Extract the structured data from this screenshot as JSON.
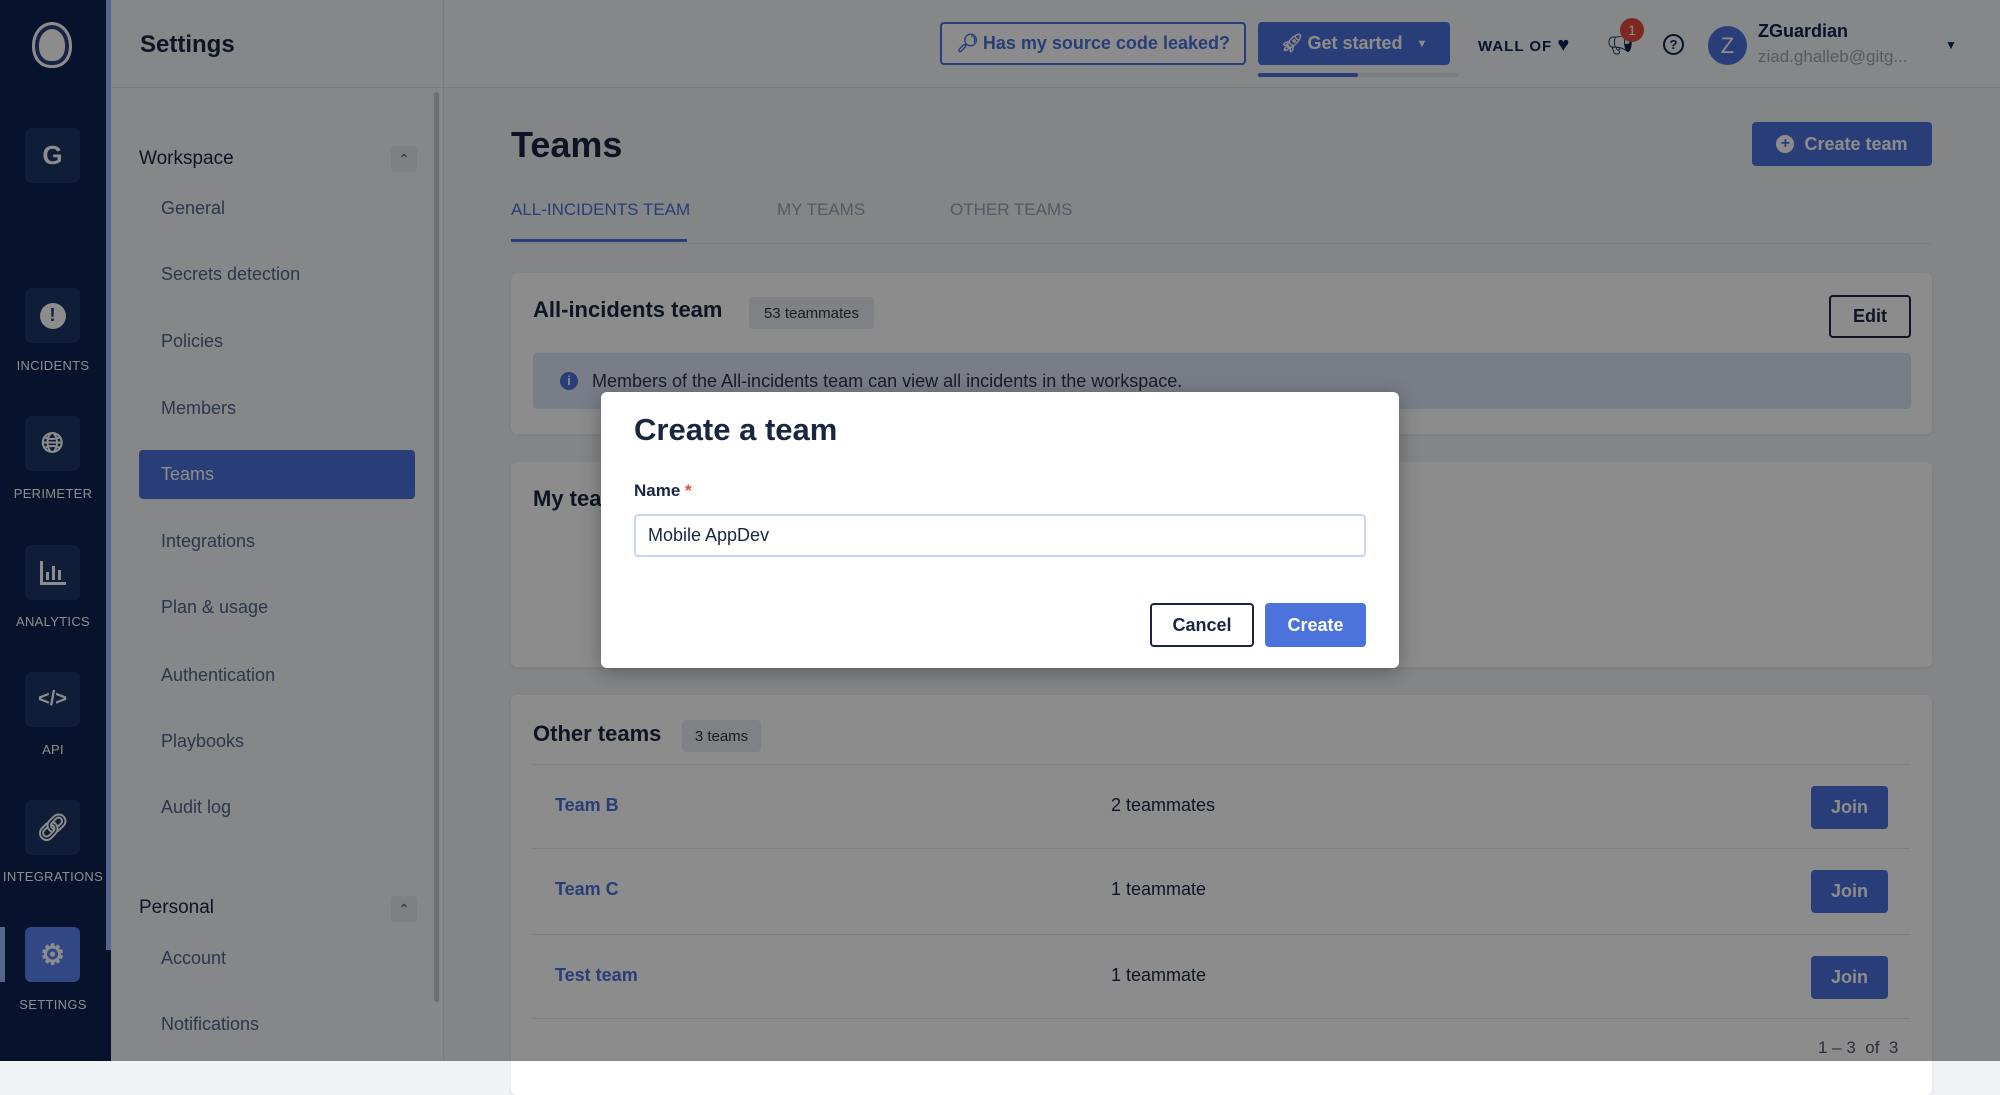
{
  "rail": {
    "workspace_initial": "G",
    "items": [
      {
        "label": "INCIDENTS",
        "icon": "alert-icon"
      },
      {
        "label": "PERIMETER",
        "icon": "globe-icon"
      },
      {
        "label": "ANALYTICS",
        "icon": "chart-icon"
      },
      {
        "label": "API",
        "icon": "code-icon"
      },
      {
        "label": "INTEGRATIONS",
        "icon": "link-icon"
      },
      {
        "label": "SETTINGS",
        "icon": "gear-icon"
      }
    ],
    "active": "SETTINGS"
  },
  "settings": {
    "title": "Settings",
    "workspace_label": "Workspace",
    "workspace_items": [
      "General",
      "Secrets detection",
      "Policies",
      "Members",
      "Teams",
      "Integrations",
      "Plan & usage",
      "Authentication",
      "Playbooks",
      "Audit log"
    ],
    "active": "Teams",
    "personal_label": "Personal",
    "personal_items": [
      "Account",
      "Notifications"
    ]
  },
  "topbar": {
    "leak_button": "Has my source code leaked?",
    "get_started": "Get started",
    "get_started_progress": 0.5,
    "wall_of": "WALL OF",
    "notification_count": "1",
    "user_initial": "Z",
    "user_name": "ZGuardian",
    "user_email": "ziad.ghalleb@gitg..."
  },
  "main": {
    "title": "Teams",
    "create_team": "Create team",
    "tabs": [
      "ALL-INCIDENTS TEAM",
      "MY TEAMS",
      "OTHER TEAMS"
    ],
    "active_tab": "ALL-INCIDENTS TEAM",
    "all_incidents": {
      "title": "All-incidents team",
      "badge": "53 teammates",
      "edit": "Edit",
      "info": "Members of the All-incidents team can view all incidents in the workspace."
    },
    "my_teams": {
      "title": "My teams"
    },
    "other_teams": {
      "title": "Other teams",
      "badge": "3 teams",
      "rows": [
        {
          "name": "Team B",
          "count": "2 teammates",
          "action": "Join"
        },
        {
          "name": "Team C",
          "count": "1 teammate",
          "action": "Join"
        },
        {
          "name": "Test team",
          "count": "1 teammate",
          "action": "Join"
        }
      ],
      "pagination": "1 – 3  of  3"
    }
  },
  "modal": {
    "title": "Create a team",
    "name_label": "Name",
    "required_mark": "*",
    "name_value": "Mobile AppDev",
    "cancel": "Cancel",
    "create": "Create"
  },
  "colors": {
    "accent": "#4c72db",
    "rail": "#0d2150"
  }
}
